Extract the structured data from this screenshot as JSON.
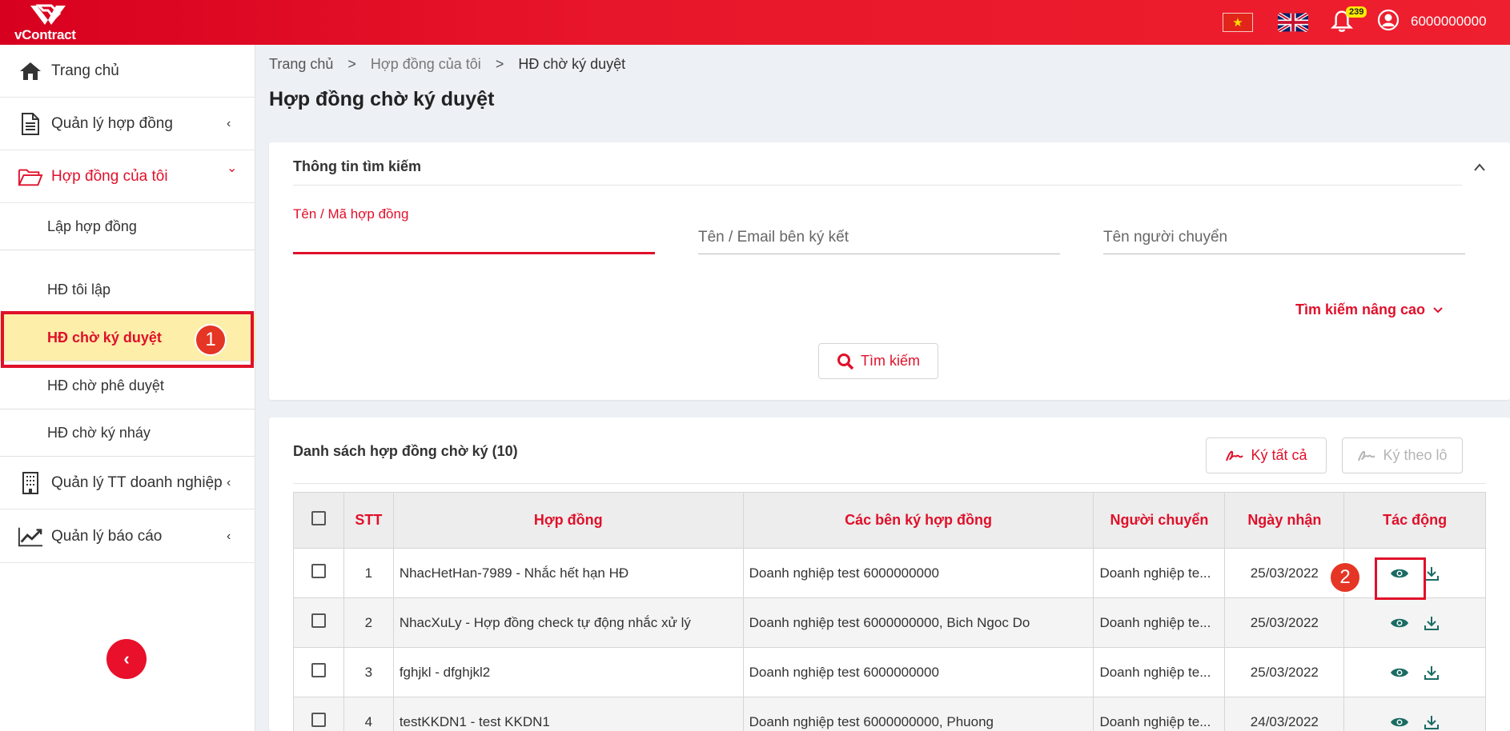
{
  "topbar": {
    "logo_text": "vContract",
    "notification_count": "239",
    "username": "6000000000",
    "colors": {
      "bar": "#e8162a",
      "accent": "#e0102a",
      "badge": "#ffea00"
    }
  },
  "sidebar": {
    "items": [
      {
        "label": "Trang chủ",
        "icon": "home-icon"
      },
      {
        "label": "Quản lý hợp đồng",
        "icon": "document-icon",
        "chevron": "‹"
      },
      {
        "label": "Hợp đồng của tôi",
        "icon": "folder-open-icon",
        "chevron": "⌄"
      },
      {
        "label": "Quản lý TT doanh nghiệp",
        "icon": "building-icon",
        "chevron": "‹"
      },
      {
        "label": "Quản lý báo cáo",
        "icon": "chart-line-icon",
        "chevron": "‹"
      }
    ],
    "sub_items": [
      {
        "label": "Lập hợp đồng"
      },
      {
        "label": "HĐ tôi lập"
      },
      {
        "label": "HĐ chờ ký duyệt"
      },
      {
        "label": "HĐ chờ phê duyệt"
      },
      {
        "label": "HĐ chờ ký nháy"
      }
    ],
    "collapse_glyph": "‹"
  },
  "annotations": {
    "step1": "1",
    "step2": "2"
  },
  "breadcrumb": {
    "home": "Trang chủ",
    "parent": "Hợp đồng của tôi",
    "current": "HĐ chờ ký duyệt",
    "sep": ">"
  },
  "page_title": "Hợp đồng chờ ký duyệt",
  "search": {
    "title": "Thông tin tìm kiếm",
    "fields": [
      {
        "label": "Tên / Mã hợp đồng",
        "value": ""
      },
      {
        "label": "Tên / Email bên ký kết",
        "value": ""
      },
      {
        "label": "Tên người chuyển",
        "value": ""
      }
    ],
    "advanced_label": "Tìm kiếm nâng cao",
    "button_label": "Tìm kiếm"
  },
  "list": {
    "title": "Danh sách hợp đồng chờ ký (10)",
    "sign_all_label": "Ký tất cả",
    "sign_batch_label": "Ký theo lô",
    "columns": [
      "STT",
      "Hợp đồng",
      "Các bên ký hợp đồng",
      "Người chuyển",
      "Ngày nhận",
      "Tác động"
    ],
    "rows": [
      {
        "stt": "1",
        "contract": "NhacHetHan-7989 - Nhắc hết hạn HĐ",
        "parties": "Doanh nghiệp test 6000000000",
        "sender": "Doanh nghiệp te...",
        "date": "25/03/2022"
      },
      {
        "stt": "2",
        "contract": "NhacXuLy - Hợp đồng check tự động nhắc xử lý",
        "parties": "Doanh nghiệp test 6000000000, Bich Ngoc Do",
        "sender": "Doanh nghiệp te...",
        "date": "25/03/2022"
      },
      {
        "stt": "3",
        "contract": "fghjkl - dfghjkl2",
        "parties": "Doanh nghiệp test 6000000000",
        "sender": "Doanh nghiệp te...",
        "date": "25/03/2022"
      },
      {
        "stt": "4",
        "contract": "testKKDN1 - test KKDN1",
        "parties": "Doanh nghiệp test 6000000000, Phuong",
        "sender": "Doanh nghiệp te...",
        "date": "24/03/2022"
      }
    ]
  }
}
